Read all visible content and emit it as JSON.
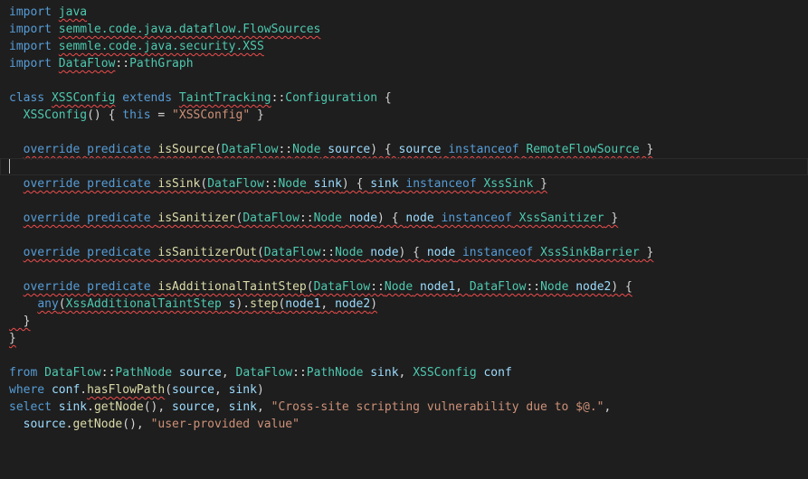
{
  "editor": {
    "colors": {
      "background": "#1e1e1e",
      "keyword": "#569cd6",
      "type": "#4ec9b0",
      "function": "#dcdcaa",
      "variable": "#9cdcfe",
      "string": "#ce9178",
      "default": "#d4d4d4",
      "error_squiggle": "#f14c4c"
    },
    "lines": [
      {
        "tokens": [
          {
            "t": "import",
            "c": "keyword"
          },
          {
            "t": " ",
            "c": "default"
          },
          {
            "t": "java",
            "c": "type",
            "sq": true
          }
        ]
      },
      {
        "tokens": [
          {
            "t": "import",
            "c": "keyword"
          },
          {
            "t": " ",
            "c": "default"
          },
          {
            "t": "semmle.code.java.dataflow.FlowSources",
            "c": "type",
            "sq": true
          }
        ]
      },
      {
        "tokens": [
          {
            "t": "import",
            "c": "keyword"
          },
          {
            "t": " ",
            "c": "default"
          },
          {
            "t": "semmle.code.java.security.XSS",
            "c": "type",
            "sq": true
          }
        ]
      },
      {
        "tokens": [
          {
            "t": "import",
            "c": "keyword"
          },
          {
            "t": " ",
            "c": "default"
          },
          {
            "t": "DataFlow",
            "c": "type",
            "sq": true
          },
          {
            "t": "::",
            "c": "default"
          },
          {
            "t": "PathGraph",
            "c": "type"
          }
        ]
      },
      {
        "tokens": []
      },
      {
        "tokens": [
          {
            "t": "class",
            "c": "keyword"
          },
          {
            "t": " ",
            "c": "default"
          },
          {
            "t": "XSSConfig",
            "c": "type",
            "sq": true
          },
          {
            "t": " ",
            "c": "default"
          },
          {
            "t": "extends",
            "c": "keyword"
          },
          {
            "t": " ",
            "c": "default"
          },
          {
            "t": "TaintTracking",
            "c": "type",
            "sq": true
          },
          {
            "t": "::",
            "c": "default"
          },
          {
            "t": "Configuration",
            "c": "type"
          },
          {
            "t": " {",
            "c": "default"
          }
        ]
      },
      {
        "tokens": [
          {
            "t": "  ",
            "c": "default"
          },
          {
            "t": "XSSConfig",
            "c": "type"
          },
          {
            "t": "() { ",
            "c": "default"
          },
          {
            "t": "this",
            "c": "keyword"
          },
          {
            "t": " = ",
            "c": "default"
          },
          {
            "t": "\"XSSConfig\"",
            "c": "string"
          },
          {
            "t": " }",
            "c": "default"
          }
        ]
      },
      {
        "tokens": []
      },
      {
        "tokens": [
          {
            "t": "  ",
            "c": "default"
          },
          {
            "t": "override predicate isSource(DataFlow::Node source) { source instanceof RemoteFlowSource }",
            "c": "mixed",
            "sq": true,
            "parts": [
              {
                "t": "override",
                "c": "keyword"
              },
              {
                "t": " ",
                "c": "default"
              },
              {
                "t": "predicate",
                "c": "keyword"
              },
              {
                "t": " ",
                "c": "default"
              },
              {
                "t": "isSource",
                "c": "function"
              },
              {
                "t": "(",
                "c": "default"
              },
              {
                "t": "DataFlow",
                "c": "type"
              },
              {
                "t": "::",
                "c": "default"
              },
              {
                "t": "Node",
                "c": "type"
              },
              {
                "t": " ",
                "c": "default"
              },
              {
                "t": "source",
                "c": "variable"
              },
              {
                "t": ") { ",
                "c": "default"
              },
              {
                "t": "source",
                "c": "variable"
              },
              {
                "t": " ",
                "c": "default"
              },
              {
                "t": "instanceof",
                "c": "keyword"
              },
              {
                "t": " ",
                "c": "default"
              },
              {
                "t": "RemoteFlowSource",
                "c": "type"
              },
              {
                "t": " }",
                "c": "default"
              }
            ]
          }
        ]
      },
      {
        "current": true,
        "tokens": []
      },
      {
        "tokens": [
          {
            "t": "  ",
            "c": "default"
          },
          {
            "t": "",
            "c": "mixed",
            "sq": true,
            "parts": [
              {
                "t": "override",
                "c": "keyword"
              },
              {
                "t": " ",
                "c": "default"
              },
              {
                "t": "predicate",
                "c": "keyword"
              },
              {
                "t": " ",
                "c": "default"
              },
              {
                "t": "isSink",
                "c": "function"
              },
              {
                "t": "(",
                "c": "default"
              },
              {
                "t": "DataFlow",
                "c": "type"
              },
              {
                "t": "::",
                "c": "default"
              },
              {
                "t": "Node",
                "c": "type"
              },
              {
                "t": " ",
                "c": "default"
              },
              {
                "t": "sink",
                "c": "variable"
              },
              {
                "t": ") { ",
                "c": "default"
              },
              {
                "t": "sink",
                "c": "variable"
              },
              {
                "t": " ",
                "c": "default"
              },
              {
                "t": "instanceof",
                "c": "keyword"
              },
              {
                "t": " ",
                "c": "default"
              },
              {
                "t": "XssSink",
                "c": "type"
              },
              {
                "t": " }",
                "c": "default"
              }
            ]
          }
        ]
      },
      {
        "tokens": []
      },
      {
        "tokens": [
          {
            "t": "  ",
            "c": "default"
          },
          {
            "t": "",
            "c": "mixed",
            "sq": true,
            "parts": [
              {
                "t": "override",
                "c": "keyword"
              },
              {
                "t": " ",
                "c": "default"
              },
              {
                "t": "predicate",
                "c": "keyword"
              },
              {
                "t": " ",
                "c": "default"
              },
              {
                "t": "isSanitizer",
                "c": "function"
              },
              {
                "t": "(",
                "c": "default"
              },
              {
                "t": "DataFlow",
                "c": "type"
              },
              {
                "t": "::",
                "c": "default"
              },
              {
                "t": "Node",
                "c": "type"
              },
              {
                "t": " ",
                "c": "default"
              },
              {
                "t": "node",
                "c": "variable"
              },
              {
                "t": ") { ",
                "c": "default"
              },
              {
                "t": "node",
                "c": "variable"
              },
              {
                "t": " ",
                "c": "default"
              },
              {
                "t": "instanceof",
                "c": "keyword"
              },
              {
                "t": " ",
                "c": "default"
              },
              {
                "t": "XssSanitizer",
                "c": "type"
              },
              {
                "t": " }",
                "c": "default"
              }
            ]
          }
        ]
      },
      {
        "tokens": []
      },
      {
        "tokens": [
          {
            "t": "  ",
            "c": "default"
          },
          {
            "t": "",
            "c": "mixed",
            "sq": true,
            "parts": [
              {
                "t": "override",
                "c": "keyword"
              },
              {
                "t": " ",
                "c": "default"
              },
              {
                "t": "predicate",
                "c": "keyword"
              },
              {
                "t": " ",
                "c": "default"
              },
              {
                "t": "isSanitizerOut",
                "c": "function"
              },
              {
                "t": "(",
                "c": "default"
              },
              {
                "t": "DataFlow",
                "c": "type"
              },
              {
                "t": "::",
                "c": "default"
              },
              {
                "t": "Node",
                "c": "type"
              },
              {
                "t": " ",
                "c": "default"
              },
              {
                "t": "node",
                "c": "variable"
              },
              {
                "t": ") { ",
                "c": "default"
              },
              {
                "t": "node",
                "c": "variable"
              },
              {
                "t": " ",
                "c": "default"
              },
              {
                "t": "instanceof",
                "c": "keyword"
              },
              {
                "t": " ",
                "c": "default"
              },
              {
                "t": "XssSinkBarrier",
                "c": "type"
              },
              {
                "t": " }",
                "c": "default"
              }
            ]
          }
        ]
      },
      {
        "tokens": []
      },
      {
        "tokens": [
          {
            "t": "  ",
            "c": "default"
          },
          {
            "t": "",
            "c": "mixed",
            "sq": true,
            "parts": [
              {
                "t": "override",
                "c": "keyword"
              },
              {
                "t": " ",
                "c": "default"
              },
              {
                "t": "predicate",
                "c": "keyword"
              },
              {
                "t": " ",
                "c": "default"
              },
              {
                "t": "isAdditionalTaintStep",
                "c": "function"
              },
              {
                "t": "(",
                "c": "default"
              },
              {
                "t": "DataFlow",
                "c": "type"
              },
              {
                "t": "::",
                "c": "default"
              },
              {
                "t": "Node",
                "c": "type"
              },
              {
                "t": " ",
                "c": "default"
              },
              {
                "t": "node1",
                "c": "variable"
              },
              {
                "t": ", ",
                "c": "default"
              },
              {
                "t": "DataFlow",
                "c": "type"
              },
              {
                "t": "::",
                "c": "default"
              },
              {
                "t": "Node",
                "c": "type"
              },
              {
                "t": " ",
                "c": "default"
              },
              {
                "t": "node2",
                "c": "variable"
              },
              {
                "t": ") {",
                "c": "default"
              }
            ]
          }
        ]
      },
      {
        "tokens": [
          {
            "t": "    ",
            "c": "default"
          },
          {
            "t": "",
            "c": "mixed",
            "sq": true,
            "parts": [
              {
                "t": "any",
                "c": "keyword"
              },
              {
                "t": "(",
                "c": "default"
              },
              {
                "t": "XssAdditionalTaintStep",
                "c": "type"
              },
              {
                "t": " ",
                "c": "default"
              },
              {
                "t": "s",
                "c": "variable"
              },
              {
                "t": ").",
                "c": "default"
              },
              {
                "t": "step",
                "c": "function"
              },
              {
                "t": "(",
                "c": "default"
              },
              {
                "t": "node1",
                "c": "variable"
              },
              {
                "t": ", ",
                "c": "default"
              },
              {
                "t": "node2",
                "c": "variable"
              },
              {
                "t": ")",
                "c": "default"
              }
            ]
          }
        ]
      },
      {
        "tokens": [
          {
            "t": "  }",
            "c": "default",
            "sq": true
          }
        ]
      },
      {
        "tokens": [
          {
            "t": "}",
            "c": "default",
            "sq": true
          }
        ]
      },
      {
        "tokens": []
      },
      {
        "tokens": [
          {
            "t": "from",
            "c": "keyword"
          },
          {
            "t": " ",
            "c": "default"
          },
          {
            "t": "DataFlow",
            "c": "type"
          },
          {
            "t": "::",
            "c": "default"
          },
          {
            "t": "PathNode",
            "c": "type"
          },
          {
            "t": " ",
            "c": "default"
          },
          {
            "t": "source",
            "c": "variable"
          },
          {
            "t": ", ",
            "c": "default"
          },
          {
            "t": "DataFlow",
            "c": "type"
          },
          {
            "t": "::",
            "c": "default"
          },
          {
            "t": "PathNode",
            "c": "type"
          },
          {
            "t": " ",
            "c": "default"
          },
          {
            "t": "sink",
            "c": "variable"
          },
          {
            "t": ", ",
            "c": "default"
          },
          {
            "t": "XSSConfig",
            "c": "type"
          },
          {
            "t": " ",
            "c": "default"
          },
          {
            "t": "conf",
            "c": "variable"
          }
        ]
      },
      {
        "tokens": [
          {
            "t": "where",
            "c": "keyword"
          },
          {
            "t": " ",
            "c": "default"
          },
          {
            "t": "conf",
            "c": "variable"
          },
          {
            "t": ".",
            "c": "default"
          },
          {
            "t": "hasFlowPath",
            "c": "function",
            "sq": true
          },
          {
            "t": "(",
            "c": "default"
          },
          {
            "t": "source",
            "c": "variable"
          },
          {
            "t": ", ",
            "c": "default"
          },
          {
            "t": "sink",
            "c": "variable"
          },
          {
            "t": ")",
            "c": "default"
          }
        ]
      },
      {
        "tokens": [
          {
            "t": "select",
            "c": "keyword"
          },
          {
            "t": " ",
            "c": "default"
          },
          {
            "t": "sink",
            "c": "variable"
          },
          {
            "t": ".",
            "c": "default"
          },
          {
            "t": "getNode",
            "c": "function"
          },
          {
            "t": "(), ",
            "c": "default"
          },
          {
            "t": "source",
            "c": "variable"
          },
          {
            "t": ", ",
            "c": "default"
          },
          {
            "t": "sink",
            "c": "variable"
          },
          {
            "t": ", ",
            "c": "default"
          },
          {
            "t": "\"Cross-site scripting vulnerability due to $@.\"",
            "c": "string"
          },
          {
            "t": ",",
            "c": "default"
          }
        ]
      },
      {
        "tokens": [
          {
            "t": "  ",
            "c": "default"
          },
          {
            "t": "source",
            "c": "variable"
          },
          {
            "t": ".",
            "c": "default"
          },
          {
            "t": "getNode",
            "c": "function"
          },
          {
            "t": "(), ",
            "c": "default"
          },
          {
            "t": "\"user-provided value\"",
            "c": "string"
          }
        ]
      }
    ]
  }
}
